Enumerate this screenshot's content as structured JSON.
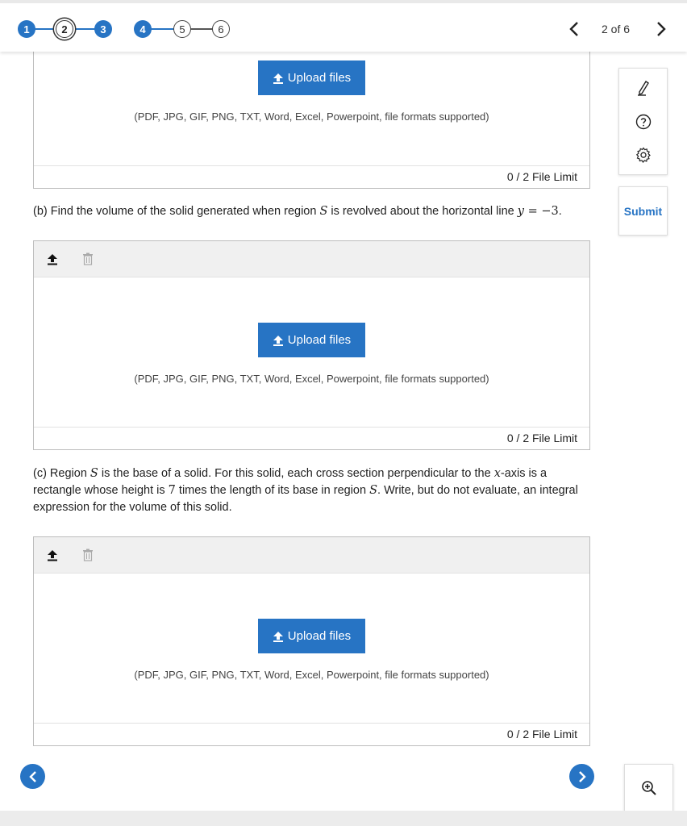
{
  "header": {
    "steps": [
      "1",
      "2",
      "3",
      "4",
      "5",
      "6"
    ],
    "current_step": 2,
    "page_indicator": "2 of 6",
    "prev_icon": "chevron-left-icon",
    "next_icon": "chevron-right-icon"
  },
  "tools": {
    "items": [
      "pencil-icon",
      "help-icon",
      "settings-icon"
    ],
    "submit_label": "Submit",
    "zoom_icon": "zoom-in-icon"
  },
  "upload": {
    "button_label": "Upload files",
    "formats_note": "(PDF, JPG, GIF, PNG, TXT, Word, Excel, Powerpoint, file formats supported)",
    "limit_text": "0 / 2 File Limit"
  },
  "questions": {
    "b": {
      "prefix": "(b) Find the volume of the solid generated when region ",
      "S": "S",
      "middle": " is revolved about the horizontal line ",
      "y": "y",
      "equals": " = −3",
      "suffix": "."
    },
    "c": {
      "p1": "(c) Region ",
      "S1": "S",
      "p2": " is the base of a solid. For this solid, each cross section perpendicular to the ",
      "x": "x",
      "p3": "-axis is a rectangle whose height is ",
      "seven": "7",
      "p4": " times the length of its base in region ",
      "S2": "S",
      "p5": ". Write, but do not evaluate, an integral expression for the volume of this solid."
    }
  },
  "colors": {
    "accent": "#2774c4",
    "toolbar_bg": "#f0f0f0",
    "border": "#bdbdbd"
  }
}
